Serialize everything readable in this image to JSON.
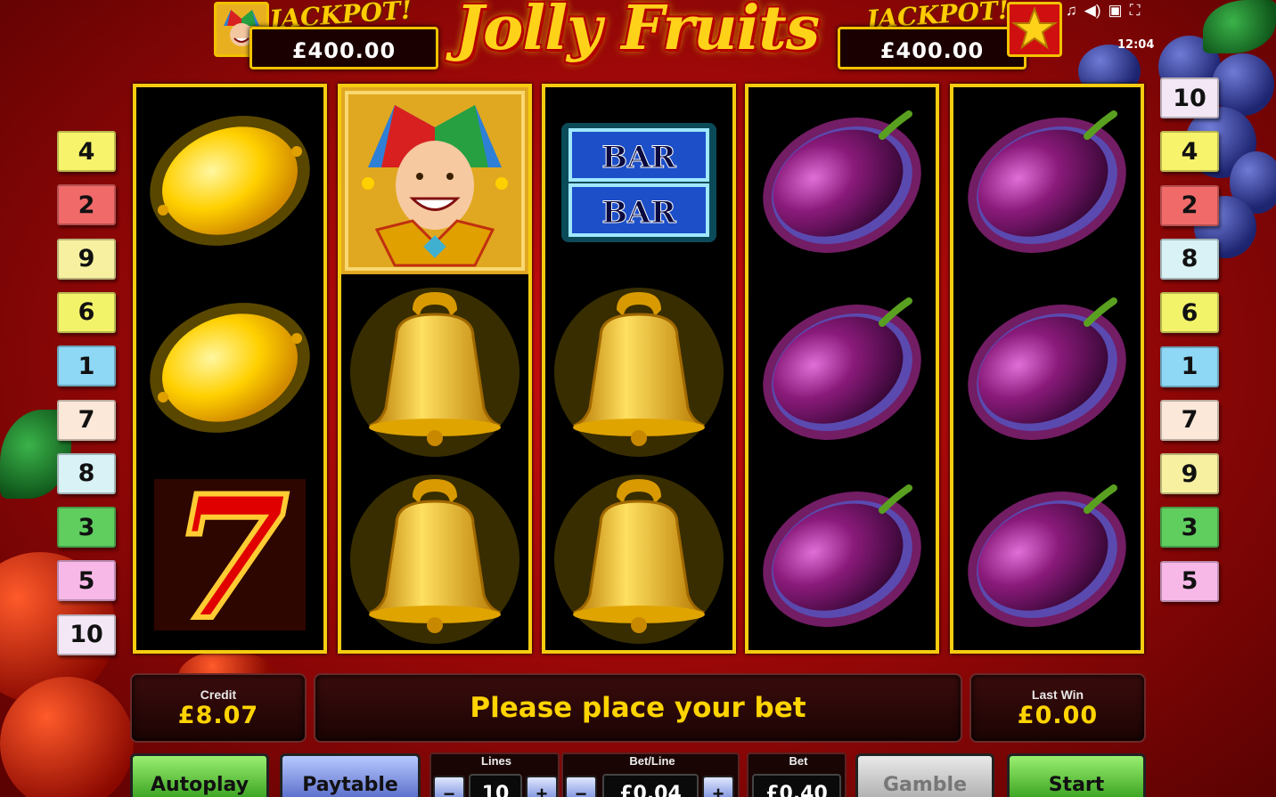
{
  "game": {
    "title": "Jolly Fruits",
    "jackpot_label": "JACKPOT!",
    "jackpot_left": "£400.00",
    "jackpot_right": "£400.00",
    "clock": "12:04"
  },
  "system_icons": [
    "music-icon",
    "volume-icon",
    "settings-icon",
    "fullscreen-icon"
  ],
  "system_icon_glyphs": [
    "♫",
    "◀)",
    "▣",
    "⛶"
  ],
  "left_markers": [
    {
      "label": "4",
      "color": "#f7f36a"
    },
    {
      "label": "2",
      "color": "#f06a6a"
    },
    {
      "label": "9",
      "color": "#f7f0a0"
    },
    {
      "label": "6",
      "color": "#f3f36a"
    },
    {
      "label": "1",
      "color": "#8ed8f5"
    },
    {
      "label": "7",
      "color": "#fbe8d8"
    },
    {
      "label": "8",
      "color": "#d8f2f5"
    },
    {
      "label": "3",
      "color": "#5fce5f"
    },
    {
      "label": "5",
      "color": "#f7b8e8"
    },
    {
      "label": "10",
      "color": "#f3e7f5"
    }
  ],
  "right_markers": [
    {
      "label": "10",
      "color": "#f3e7f5"
    },
    {
      "label": "4",
      "color": "#f7f36a"
    },
    {
      "label": "2",
      "color": "#f06a6a"
    },
    {
      "label": "8",
      "color": "#d8f2f5"
    },
    {
      "label": "6",
      "color": "#f3f36a"
    },
    {
      "label": "1",
      "color": "#8ed8f5"
    },
    {
      "label": "7",
      "color": "#fbe8d8"
    },
    {
      "label": "9",
      "color": "#f7f0a0"
    },
    {
      "label": "3",
      "color": "#5fce5f"
    },
    {
      "label": "5",
      "color": "#f7b8e8"
    }
  ],
  "reels": [
    [
      "lemon",
      "lemon",
      "seven"
    ],
    [
      "joker",
      "bell",
      "bell"
    ],
    [
      "bar",
      "bell",
      "bell"
    ],
    [
      "plum",
      "plum",
      "plum"
    ],
    [
      "plum",
      "plum",
      "plum"
    ]
  ],
  "bar_text": "BAR",
  "panels": {
    "credit_label": "Credit",
    "credit_value": "£8.07",
    "message": "Please place your bet",
    "last_win_label": "Last Win",
    "last_win_value": "£0.00"
  },
  "controls": {
    "autoplay": "Autoplay",
    "paytable": "Paytable",
    "lines_label": "Lines",
    "lines_value": "10",
    "bet_line_label": "Bet/Line",
    "bet_line_value": "£0.04",
    "bet_label": "Bet",
    "bet_value": "£0.40",
    "gamble": "Gamble",
    "start": "Start",
    "minus": "−",
    "plus": "+"
  }
}
